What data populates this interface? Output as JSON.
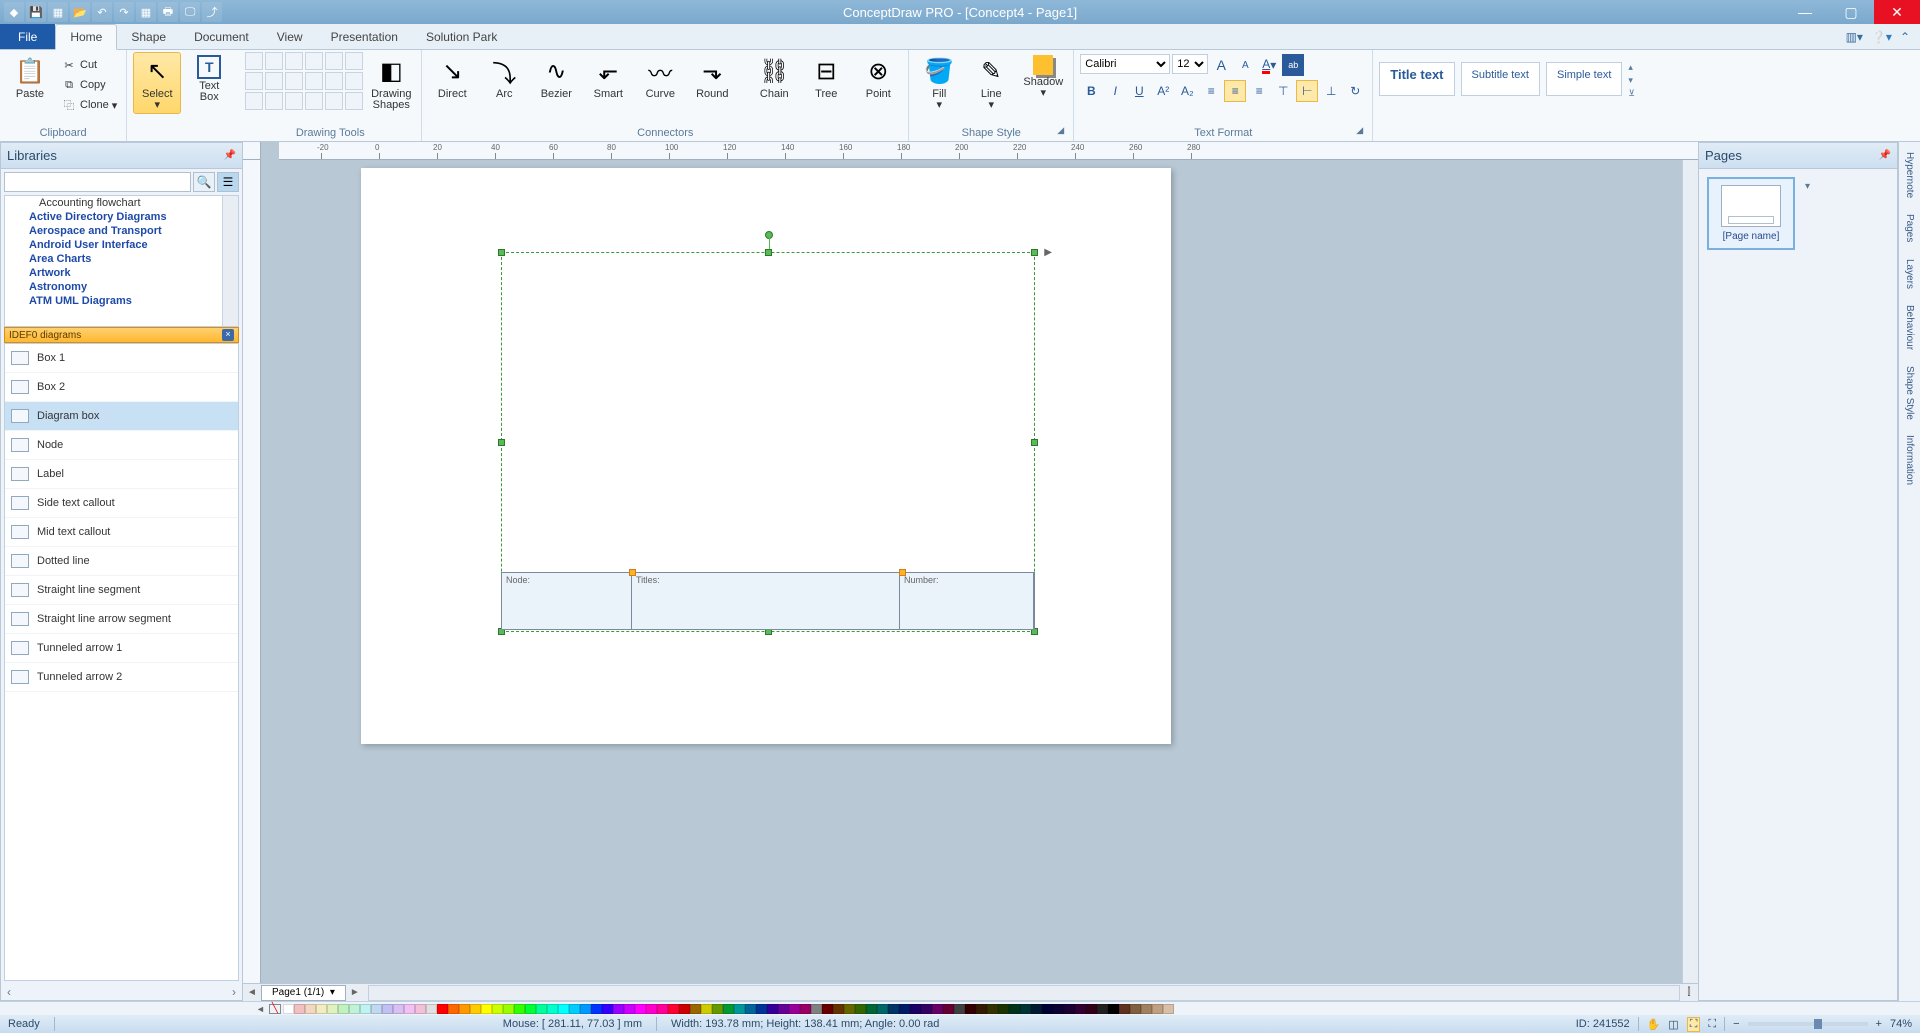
{
  "app": {
    "title": "ConceptDraw PRO - [Concept4 - Page1]"
  },
  "menu": {
    "file": "File",
    "tabs": [
      "Home",
      "Shape",
      "Document",
      "View",
      "Presentation",
      "Solution Park"
    ],
    "active": "Home"
  },
  "ribbon": {
    "clipboard": {
      "label": "Clipboard",
      "paste": "Paste",
      "cut": "Cut",
      "copy": "Copy",
      "clone": "Clone"
    },
    "select": {
      "select": "Select",
      "textbox": "Text\nBox"
    },
    "drawing": {
      "label": "Drawing Tools",
      "shapes": "Drawing\nShapes"
    },
    "connectors": {
      "label": "Connectors",
      "direct": "Direct",
      "arc": "Arc",
      "bezier": "Bezier",
      "smart": "Smart",
      "curve": "Curve",
      "round": "Round",
      "chain": "Chain",
      "tree": "Tree",
      "point": "Point"
    },
    "shapestyle": {
      "label": "Shape Style",
      "fill": "Fill",
      "line": "Line",
      "shadow": "Shadow"
    },
    "textformat": {
      "label": "Text Format",
      "font": "Calibri",
      "size": "12",
      "title": "Title text",
      "subtitle": "Subtitle text",
      "simple": "Simple text"
    }
  },
  "libraries": {
    "title": "Libraries",
    "tree": [
      "Accounting flowchart",
      "Active Directory Diagrams",
      "Aerospace and Transport",
      "Android User Interface",
      "Area Charts",
      "Artwork",
      "Astronomy",
      "ATM UML Diagrams"
    ],
    "section": "IDEF0 diagrams",
    "shapes": [
      "Box 1",
      "Box 2",
      "Diagram box",
      "Node",
      "Label",
      "Side text callout",
      "Mid text callout",
      "Dotted line",
      "Straight line segment",
      "Straight line arrow segment",
      "Tunneled arrow 1",
      "Tunneled arrow 2"
    ],
    "selected": "Diagram box"
  },
  "canvas": {
    "pageTab": "Page1 (1/1)",
    "cells": {
      "node": "Node:",
      "titles": "Titles:",
      "number": "Number:"
    }
  },
  "pages": {
    "title": "Pages",
    "thumb": "[Page name]"
  },
  "sideTabs": [
    "Hypernote",
    "Pages",
    "Layers",
    "Behaviour",
    "Shape Style",
    "Information"
  ],
  "status": {
    "ready": "Ready",
    "mouse": "Mouse: [ 281.11, 77.03 ] mm",
    "dims": "Width: 193.78 mm;  Height: 138.41 mm;  Angle: 0.00 rad",
    "id": "ID: 241552",
    "zoom": "74%"
  },
  "colors": [
    "#ffffff",
    "#f2c0c0",
    "#f2d8c0",
    "#f2ecc0",
    "#e0f2c0",
    "#c0f2c0",
    "#c0f2d8",
    "#c0f2f2",
    "#c0d8f2",
    "#c0c0f2",
    "#d8c0f2",
    "#f2c0f2",
    "#f2c0d8",
    "#e0e0e0",
    "#ff0000",
    "#ff6600",
    "#ff9900",
    "#ffcc00",
    "#ffff00",
    "#ccff00",
    "#99ff00",
    "#33ff00",
    "#00ff33",
    "#00ff99",
    "#00ffcc",
    "#00ffff",
    "#00ccff",
    "#0099ff",
    "#0033ff",
    "#3300ff",
    "#9900ff",
    "#cc00ff",
    "#ff00ff",
    "#ff00cc",
    "#ff0099",
    "#ff0033",
    "#cc0000",
    "#996600",
    "#cccc00",
    "#669900",
    "#009933",
    "#009999",
    "#006699",
    "#003399",
    "#330099",
    "#660099",
    "#990099",
    "#990066",
    "#808080",
    "#660000",
    "#663300",
    "#666600",
    "#336600",
    "#006633",
    "#006666",
    "#003366",
    "#001a66",
    "#1a0066",
    "#330066",
    "#660066",
    "#660033",
    "#404040",
    "#330000",
    "#331a00",
    "#333300",
    "#1a3300",
    "#00331a",
    "#003333",
    "#001a33",
    "#000033",
    "#0d0033",
    "#1a0033",
    "#330033",
    "#33001a",
    "#202020",
    "#000000",
    "#603020",
    "#806040",
    "#a08060",
    "#c0a080",
    "#d8c0a8"
  ]
}
